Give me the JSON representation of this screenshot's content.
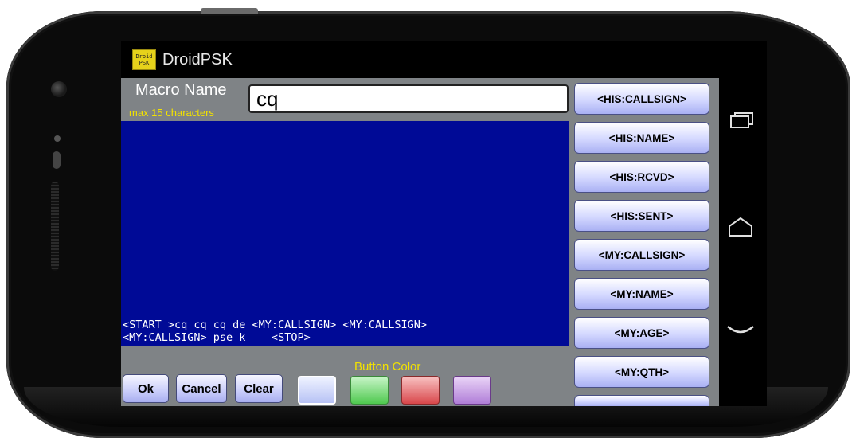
{
  "app": {
    "title": "DroidPSK",
    "icon_label": "Droid PSK"
  },
  "form": {
    "macro_name_label": "Macro Name",
    "max_chars_hint": "max 15 characters",
    "macro_name_value": "cq"
  },
  "editor": {
    "text": "<START >cq cq cq de <MY:CALLSIGN> <MY:CALLSIGN>\n<MY:CALLSIGN> pse k    <STOP>"
  },
  "bottom": {
    "button_color_label": "Button Color",
    "ok_label": "Ok",
    "cancel_label": "Cancel",
    "clear_label": "Clear",
    "color_options": [
      "blue",
      "green",
      "red",
      "purple"
    ],
    "selected_color": "blue"
  },
  "macro_buttons": [
    "<HIS:CALLSIGN>",
    "<HIS:NAME>",
    "<HIS:RCVD>",
    "<HIS:SENT>",
    "<MY:CALLSIGN>",
    "<MY:NAME>",
    "<MY:AGE>",
    "<MY:QTH>"
  ],
  "system_nav": [
    "recent-apps-icon",
    "home-icon",
    "back-icon"
  ],
  "colors": {
    "editor_bg": "#000a96",
    "panel_gray": "#7f8386",
    "hint_yellow": "#f2e200",
    "button_blue": "#c9cdfa"
  }
}
